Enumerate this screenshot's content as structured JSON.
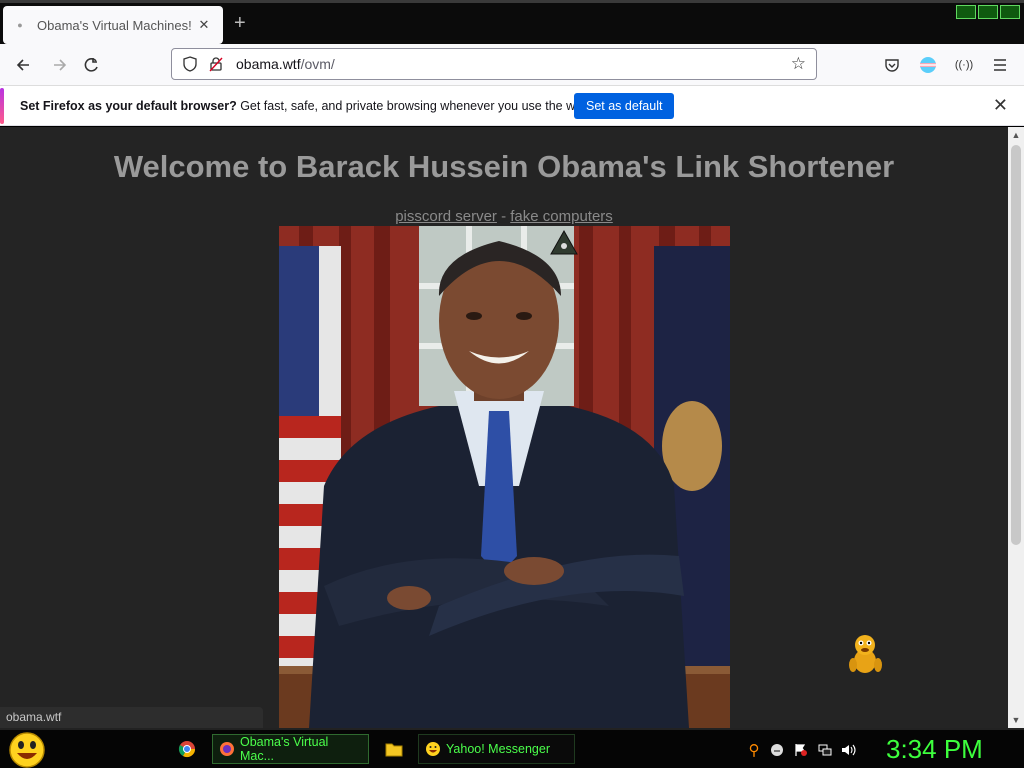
{
  "browser": {
    "tab": {
      "title": "Obama's Virtual Machines!",
      "close": "✕"
    },
    "new_tab": "+",
    "url": {
      "domain": "obama.wtf",
      "path": "/ovm/"
    }
  },
  "notification": {
    "bold": "Set Firefox as your default browser?",
    "text": " Get fast, safe, and private browsing whenever you use the web.",
    "button": "Set as default",
    "close": "✕"
  },
  "page": {
    "heading": "Welcome to Barack Hussein Obama's Link Shortener",
    "link1": "pisscord server",
    "separator": " - ",
    "link2": "fake computers",
    "image_alt": "Official portrait photo"
  },
  "status_bar": {
    "url": "obama.wtf"
  },
  "taskbar": {
    "tasks": [
      {
        "label": "Obama's Virtual Mac...",
        "icon": "firefox-icon"
      },
      {
        "label": "Yahoo! Messenger",
        "icon": "yahoo-messenger-icon"
      }
    ],
    "clock": "3:34 PM"
  },
  "colors": {
    "page_bg": "#242424",
    "heading": "#9a9a9a",
    "accent_button": "#0061e0",
    "taskbar_text": "#4bff4b",
    "clock": "#3dff3d"
  }
}
